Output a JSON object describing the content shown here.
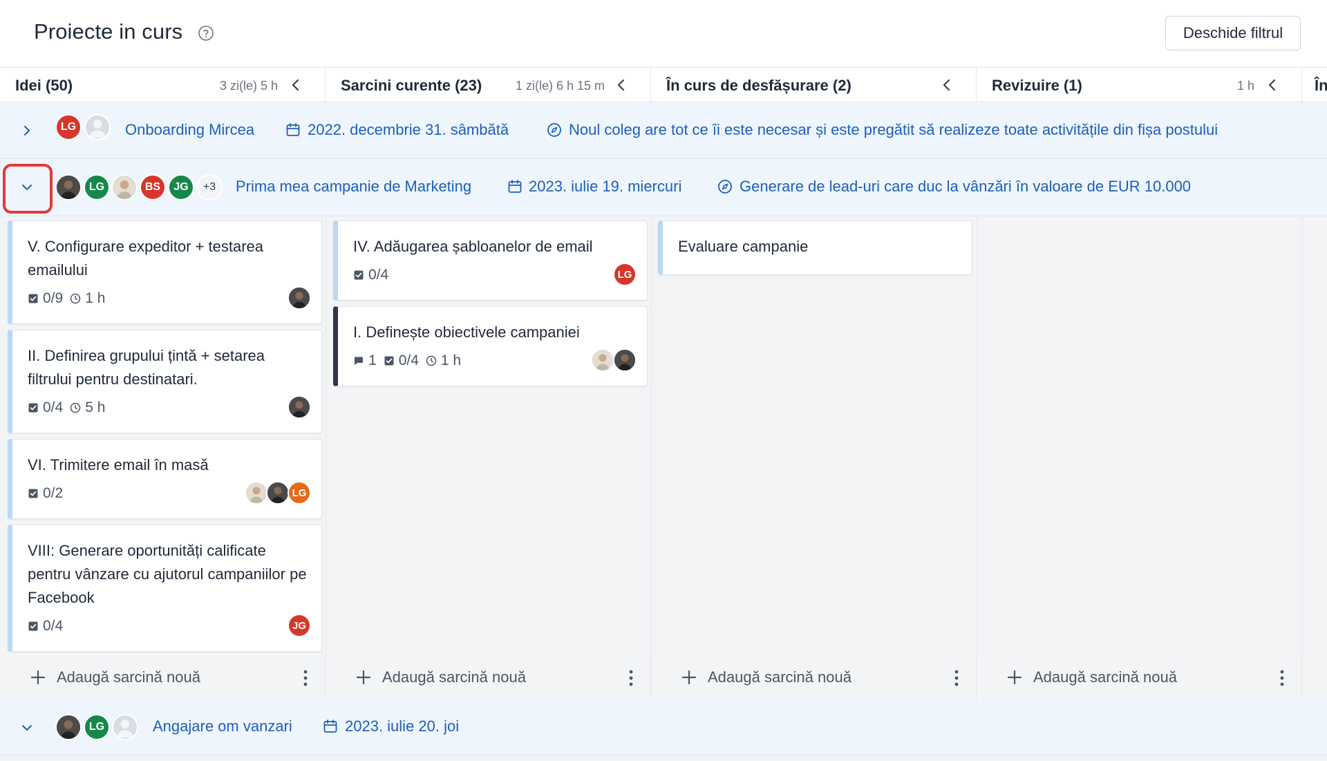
{
  "header": {
    "title": "Proiecte in curs",
    "filter_button": "Deschide filtrul"
  },
  "columns": [
    {
      "name": "Idei (50)",
      "time": "3 zi(le) 5 h"
    },
    {
      "name": "Sarcini curente (23)",
      "time": "1 zi(le) 6 h 15 m"
    },
    {
      "name": "În curs de desfășurare (2)",
      "time": ""
    },
    {
      "name": "Revizuire (1)",
      "time": "1 h"
    },
    {
      "name": "În",
      "time": ""
    }
  ],
  "lanes": {
    "onboarding": {
      "name": "Onboarding Mircea",
      "date": "2022. decembrie 31. sâmbătă",
      "goal": "Noul coleg are tot ce îi este necesar și este pregătit să realizeze toate activitățile din fișa postului",
      "avatars": [
        "LG"
      ]
    },
    "marketing": {
      "name": "Prima mea campanie de Marketing",
      "date": "2023. iulie 19. miercuri",
      "goal": "Generare de lead-uri care duc la vânzări în valoare de EUR 10.000",
      "avatars": [
        "LG",
        "BS",
        "JG"
      ],
      "more": "+3"
    },
    "angajare": {
      "name": "Angajare om vanzari",
      "date": "2023. iulie 20. joi",
      "avatars": [
        "LG"
      ]
    }
  },
  "cards": {
    "c1": {
      "title": "V. Configurare expeditor + testarea emailului",
      "checklist": "0/9",
      "time": "1 h"
    },
    "c2": {
      "title": "II. Definirea grupului țintă + setarea filtrului pentru destinatari.",
      "checklist": "0/4",
      "time": "5 h"
    },
    "c3": {
      "title": "VI. Trimitere email în masă",
      "checklist": "0/2",
      "avatar": "LG"
    },
    "c4": {
      "title": "VIII: Generare oportunități calificate pentru vânzare cu ajutorul campaniilor pe Facebook",
      "checklist": "0/4",
      "avatar": "JG"
    },
    "c5": {
      "title": "IV. Adăugarea șabloanelor de email",
      "checklist": "0/4",
      "avatar": "LG"
    },
    "c6": {
      "title": "I. Definește obiectivele campaniei",
      "comments": "1",
      "checklist": "0/4",
      "time": "1 h"
    },
    "c7": {
      "title": "Evaluare campanie"
    }
  },
  "add_task_label": "Adaugă sarcină nouă"
}
